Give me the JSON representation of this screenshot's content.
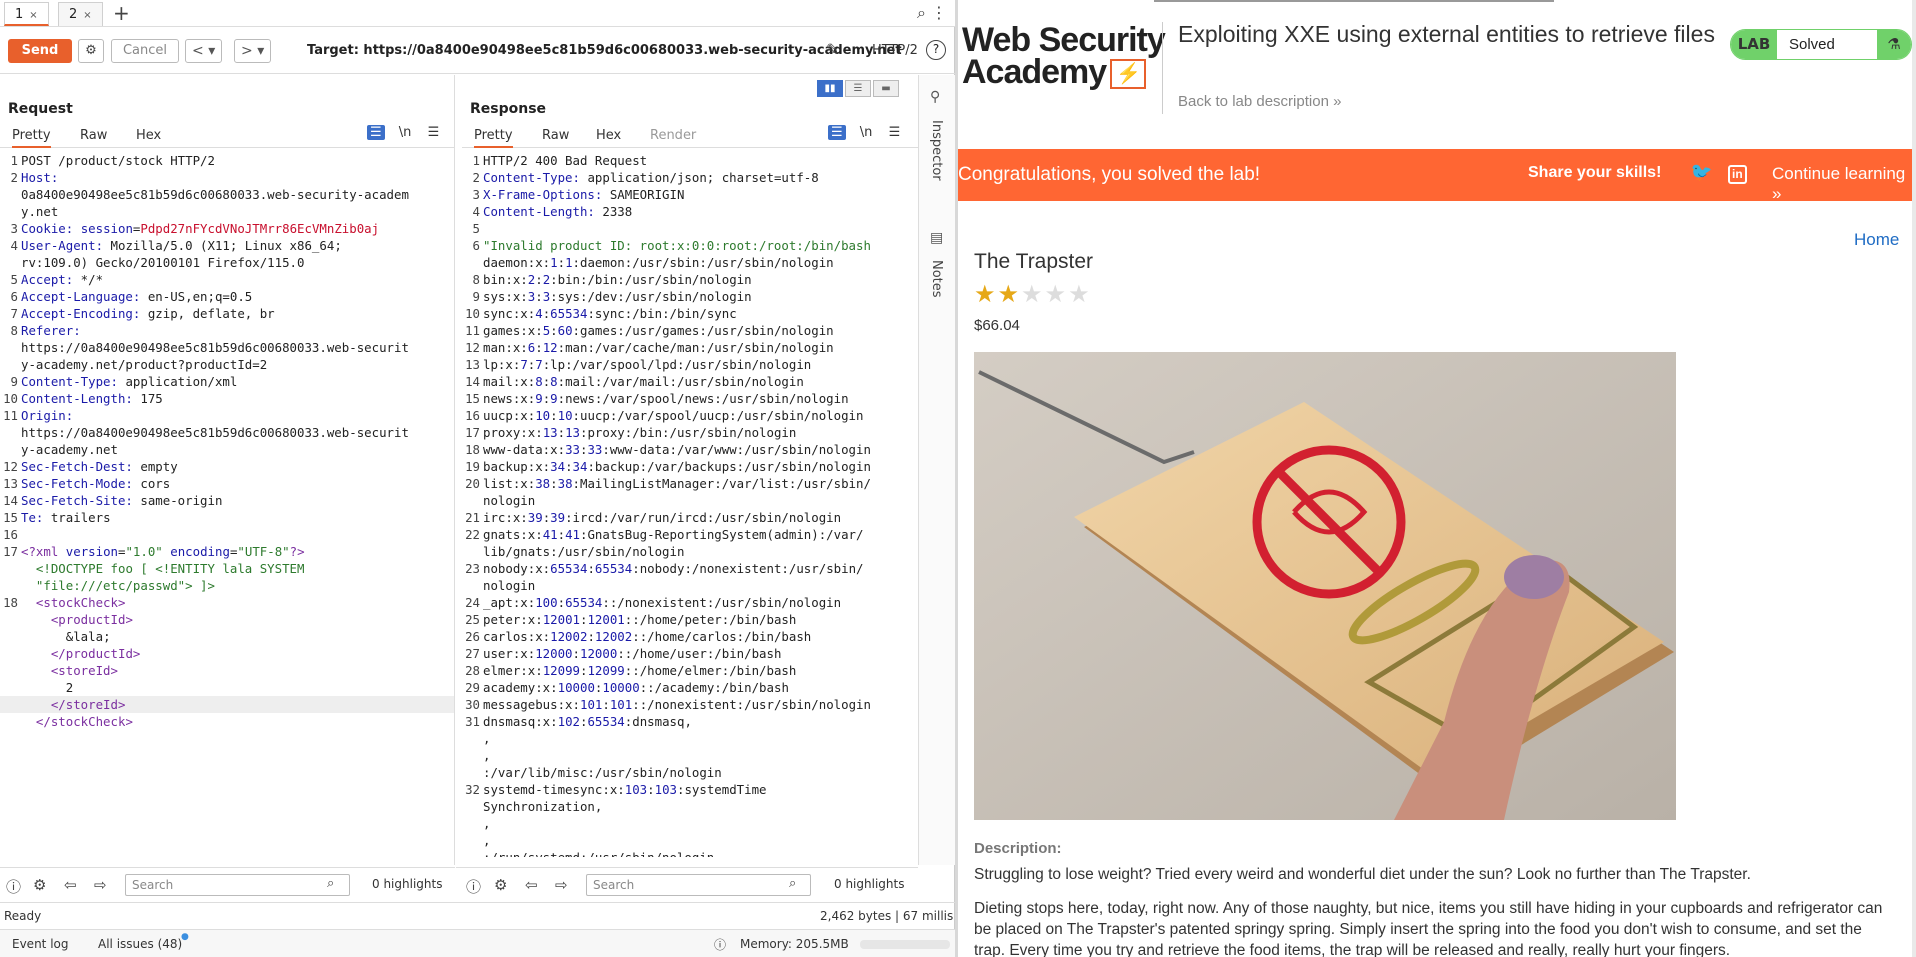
{
  "tabs": [
    {
      "label": "1",
      "close": "×"
    },
    {
      "label": "2",
      "close": "×"
    }
  ],
  "new_tab": "+",
  "toolbar": {
    "send": "Send",
    "cancel": "Cancel",
    "back": "<",
    "back_drop": "▾",
    "fwd": ">",
    "fwd_drop": "▾",
    "target": "Target: https://0a8400e90498ee5c81b59d6c00680033.web-security-academy.net",
    "protocol": "HTTP/2",
    "help": "?"
  },
  "request": {
    "title": "Request",
    "tabs": [
      "Pretty",
      "Raw",
      "Hex"
    ],
    "newline_toggle": "\\n"
  },
  "response": {
    "title": "Response",
    "tabs": [
      "Pretty",
      "Raw",
      "Hex",
      "Render"
    ],
    "newline_toggle": "\\n"
  },
  "sidebar": {
    "inspector": "Inspector",
    "notes": "Notes"
  },
  "req_bottom": {
    "search_placeholder": "Search",
    "highlights": "0 highlights"
  },
  "resp_bottom": {
    "search_placeholder": "Search",
    "highlights": "0 highlights"
  },
  "status": {
    "ready": "Ready",
    "bytes": "2,462 bytes | 67 millis"
  },
  "footer": {
    "event_log": "Event log",
    "all_issues": "All issues (48)",
    "memory": "Memory: 205.5MB"
  },
  "web": {
    "logo_line1": "Web Security",
    "logo_line2": "Academy",
    "lab_title": "Exploiting XXE using external entities to retrieve files",
    "back_link": "Back to lab description",
    "lab_badge": "LAB",
    "lab_status": "Solved",
    "banner_text": "Congratulations, you solved the lab!",
    "share_text": "Share your skills!",
    "continue": "Continue learning",
    "home": "Home",
    "product_title": "The Trapster",
    "rating": 2,
    "rating_max": 5,
    "price": "$66.04",
    "desc_label": "Description:",
    "desc1": "Struggling to lose weight? Tried every weird and wonderful diet under the sun? Look no further than The Trapster.",
    "desc2": "Dieting stops here, today, right now. Any of those naughty, but nice, items you still have hiding in your cupboards and refrigerator can be placed on The Trapster's patented springy spring. Simply insert the spring into the food you don't wish to consume, and set the trap. Every time you try and retrieve the food items, the trap will be released and really, really hurt your fingers."
  },
  "colors": {
    "accent": "#e8602c",
    "banner": "#ff6633",
    "lab_green": "#70d16a",
    "link": "#1f6cc4"
  }
}
